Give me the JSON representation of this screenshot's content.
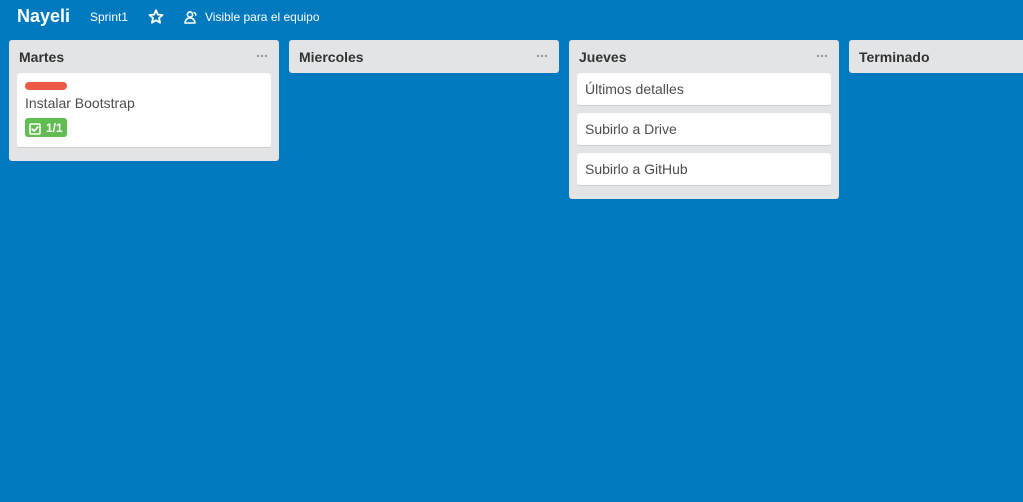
{
  "header": {
    "board_title": "Nayeli",
    "team_name": "Sprint1",
    "visibility_label": "Visible para el equipo"
  },
  "lists": [
    {
      "title": "Martes",
      "cards": [
        {
          "title": "Instalar Bootstrap",
          "label_color": "#eb5a46",
          "checklist": "1/1"
        }
      ]
    },
    {
      "title": "Miercoles",
      "cards": []
    },
    {
      "title": "Jueves",
      "cards": [
        {
          "title": "Últimos detalles"
        },
        {
          "title": "Subirlo a Drive"
        },
        {
          "title": "Subirlo a GitHub"
        }
      ]
    },
    {
      "title": "Terminado",
      "cards": []
    }
  ],
  "colors": {
    "board_background": "#0079bf",
    "list_background": "#e2e4e6",
    "label_red": "#eb5a46",
    "checklist_complete": "#61bd4f"
  }
}
